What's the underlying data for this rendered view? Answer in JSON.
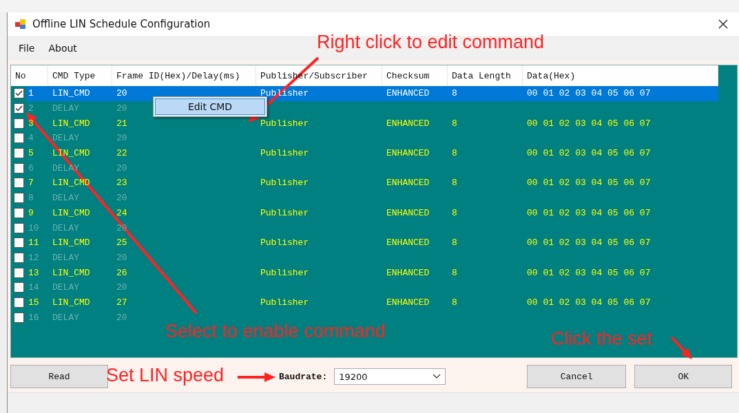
{
  "window": {
    "title": "Offline LIN  Schedule Configuration"
  },
  "menu": [
    "File",
    "About"
  ],
  "table": {
    "columns": [
      "No",
      "CMD Type",
      "Frame ID(Hex)/Delay(ms)",
      "Publisher/Subscriber",
      "Checksum",
      "Data Length",
      "Data(Hex)"
    ],
    "rows": [
      {
        "kind": "cmd",
        "checked": true,
        "selected": true,
        "cells": [
          "1",
          "LIN_CMD",
          "20",
          "Publisher",
          "ENHANCED",
          "8",
          "00 01 02 03 04 05 06 07"
        ]
      },
      {
        "kind": "delay",
        "checked": true,
        "selected": false,
        "cells": [
          "2",
          "DELAY",
          "20"
        ]
      },
      {
        "kind": "cmd",
        "checked": false,
        "selected": false,
        "cells": [
          "3",
          "LIN_CMD",
          "21",
          "Publisher",
          "ENHANCED",
          "8",
          "00 01 02 03 04 05 06 07"
        ]
      },
      {
        "kind": "delay",
        "checked": false,
        "selected": false,
        "cells": [
          "4",
          "DELAY",
          "20"
        ]
      },
      {
        "kind": "cmd",
        "checked": false,
        "selected": false,
        "cells": [
          "5",
          "LIN_CMD",
          "22",
          "Publisher",
          "ENHANCED",
          "8",
          "00 01 02 03 04 05 06 07"
        ]
      },
      {
        "kind": "delay",
        "checked": false,
        "selected": false,
        "cells": [
          "6",
          "DELAY",
          "20"
        ]
      },
      {
        "kind": "cmd",
        "checked": false,
        "selected": false,
        "cells": [
          "7",
          "LIN_CMD",
          "23",
          "Publisher",
          "ENHANCED",
          "8",
          "00 01 02 03 04 05 06 07"
        ]
      },
      {
        "kind": "delay",
        "checked": false,
        "selected": false,
        "cells": [
          "8",
          "DELAY",
          "20"
        ]
      },
      {
        "kind": "cmd",
        "checked": false,
        "selected": false,
        "cells": [
          "9",
          "LIN_CMD",
          "24",
          "Publisher",
          "ENHANCED",
          "8",
          "00 01 02 03 04 05 06 07"
        ]
      },
      {
        "kind": "delay",
        "checked": false,
        "selected": false,
        "cells": [
          "10",
          "DELAY",
          "20"
        ]
      },
      {
        "kind": "cmd",
        "checked": false,
        "selected": false,
        "cells": [
          "11",
          "LIN_CMD",
          "25",
          "Publisher",
          "ENHANCED",
          "8",
          "00 01 02 03 04 05 06 07"
        ]
      },
      {
        "kind": "delay",
        "checked": false,
        "selected": false,
        "cells": [
          "12",
          "DELAY",
          "20"
        ]
      },
      {
        "kind": "cmd",
        "checked": false,
        "selected": false,
        "cells": [
          "13",
          "LIN_CMD",
          "26",
          "Publisher",
          "ENHANCED",
          "8",
          "00 01 02 03 04 05 06 07"
        ]
      },
      {
        "kind": "delay",
        "checked": false,
        "selected": false,
        "cells": [
          "14",
          "DELAY",
          "20"
        ]
      },
      {
        "kind": "cmd",
        "checked": false,
        "selected": false,
        "cells": [
          "15",
          "LIN_CMD",
          "27",
          "Publisher",
          "ENHANCED",
          "8",
          "00 01 02 03 04 05 06 07"
        ]
      },
      {
        "kind": "delay",
        "checked": false,
        "selected": false,
        "cells": [
          "16",
          "DELAY",
          "20"
        ]
      }
    ]
  },
  "context_menu": [
    "Edit CMD"
  ],
  "bottom": {
    "read_button": "Read",
    "baudrate_label": "Baudrate:",
    "baudrate_value": "19200",
    "cancel_button": "Cancel",
    "ok_button": "OK"
  },
  "annotations": [
    {
      "text": "Right click to edit command"
    },
    {
      "text": "Select to enable command"
    },
    {
      "text": "Click the set"
    },
    {
      "text": "Set LIN speed"
    }
  ]
}
